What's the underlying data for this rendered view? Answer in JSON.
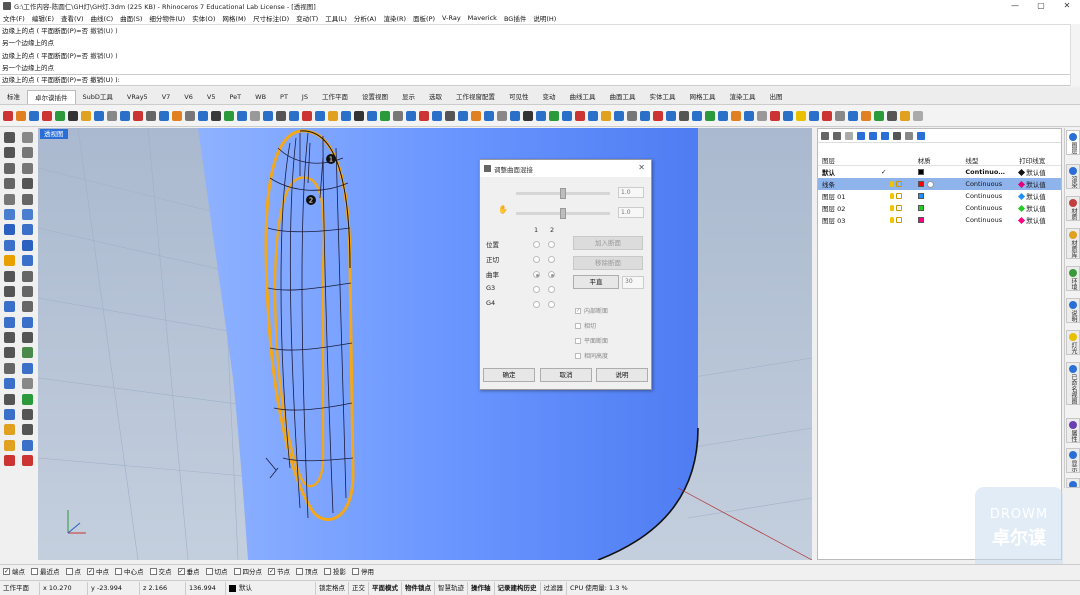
{
  "title": "G:\\工作内容-陈圆仁\\GH灯\\GH灯.3dm (225 KB) - Rhinoceros 7 Educational Lab License - [透视图]",
  "window_buttons": [
    "—",
    "▢",
    "✕"
  ],
  "menu": [
    "文件(F)",
    "编辑(E)",
    "查看(V)",
    "曲线(C)",
    "曲面(S)",
    "细分物件(U)",
    "实体(O)",
    "网格(M)",
    "尺寸标注(D)",
    "变动(T)",
    "工具(L)",
    "分析(A)",
    "渲染(R)",
    "面板(P)",
    "V-Ray",
    "Maverick",
    "BG插件",
    "说明(H)"
  ],
  "command_history": [
    {
      "text": "边缘上的点 ( 平面断面(P)=否 ",
      "underline": "撤销(U) )"
    },
    {
      "text": "另一个边缘上的点",
      "underline": ""
    },
    {
      "text": "边缘上的点 ( 平面断面(P)=否 ",
      "underline": "撤销(U) )"
    },
    {
      "text": "另一个边缘上的点",
      "underline": ""
    }
  ],
  "command_prompt": "边缘上的点 ( 平面断面(P)=否  撤销(U) ):",
  "tabs": [
    "标准",
    "卓尔谟插件",
    "SubD工具",
    "VRay5",
    "V7",
    "V6",
    "V5",
    "PeT",
    "WB",
    "PT",
    "JS",
    "工作平面",
    "设置视图",
    "显示",
    "选取",
    "工作视窗配置",
    "可见性",
    "变动",
    "曲线工具",
    "曲面工具",
    "实体工具",
    "网格工具",
    "渲染工具",
    "出图"
  ],
  "active_tab": "卓尔谟插件",
  "viewport_label": "透视图",
  "point_labels": [
    "1",
    "2"
  ],
  "dialog": {
    "title": "调整曲面混接",
    "slider_values": [
      "1.0",
      "1.0"
    ],
    "col_headers": [
      "1",
      "2"
    ],
    "rows": [
      "位置",
      "正切",
      "曲率",
      "G3",
      "G4"
    ],
    "buttons_right": {
      "add": "加入断面",
      "remove": "移除断面",
      "planar": "平直",
      "num": "30"
    },
    "checks": [
      {
        "label": "内部断面",
        "checked": true
      },
      {
        "label": "相切",
        "checked": false
      },
      {
        "label": "平面断面",
        "checked": false
      },
      {
        "label": "相同高度",
        "checked": false
      }
    ],
    "ok": "确定",
    "cancel": "取消",
    "help": "说明"
  },
  "layers": {
    "headers": {
      "name": "图层",
      "material": "材质",
      "linetype": "线型",
      "print": "打印线宽"
    },
    "rows": [
      {
        "name": "默认",
        "current": "✓",
        "color": "#000000",
        "linetype": "Continuo…",
        "print": "默认值",
        "bold": true,
        "selected": false
      },
      {
        "name": "线条",
        "current": "",
        "color": "#ff0000",
        "linetype": "Continuous",
        "print": "默认值",
        "bold": false,
        "selected": true
      },
      {
        "name": "图层 01",
        "current": "",
        "color": "#1e90ff",
        "linetype": "Continuous",
        "print": "默认值",
        "bold": false,
        "selected": false
      },
      {
        "name": "图层 02",
        "current": "",
        "color": "#22cc22",
        "linetype": "Continuous",
        "print": "默认值",
        "bold": false,
        "selected": false
      },
      {
        "name": "图层 03",
        "current": "",
        "color": "#ff0080",
        "linetype": "Continuous",
        "print": "默认值",
        "bold": false,
        "selected": false
      }
    ]
  },
  "side_tabs": [
    {
      "label": "图层",
      "color": "#2b6fd6"
    },
    {
      "label": "渲染",
      "color": "#2b6fd6"
    },
    {
      "label": "材质",
      "color": "#c04040"
    },
    {
      "label": "材质库",
      "color": "#e0a020"
    },
    {
      "label": "环境",
      "color": "#3a9a3a"
    },
    {
      "label": "说明",
      "color": "#2b6fd6"
    },
    {
      "label": "灯光",
      "color": "#e8c000"
    },
    {
      "label": "已命名视图",
      "color": "#2b6fd6"
    },
    {
      "label": "属性",
      "color": "#6a3fb0"
    },
    {
      "label": "显示",
      "color": "#2b6fd6"
    },
    {
      "label": "环境",
      "color": "#2b6fd6"
    }
  ],
  "osnaps": [
    {
      "label": "端点",
      "checked": true
    },
    {
      "label": "最近点",
      "checked": false
    },
    {
      "label": "点",
      "checked": false
    },
    {
      "label": "中点",
      "checked": true
    },
    {
      "label": "中心点",
      "checked": false
    },
    {
      "label": "交点",
      "checked": false
    },
    {
      "label": "垂点",
      "checked": true
    },
    {
      "label": "切点",
      "checked": false
    },
    {
      "label": "四分点",
      "checked": false
    },
    {
      "label": "节点",
      "checked": true
    },
    {
      "label": "顶点",
      "checked": false
    },
    {
      "label": "投影",
      "checked": false
    },
    {
      "label": "停用",
      "checked": false
    }
  ],
  "status": {
    "cplane": "工作平面",
    "x": "x 10.270",
    "y": "y -23.994",
    "z": "z 2.166",
    "dist": "136.994",
    "layer": "默认",
    "items": [
      "锁定格点",
      "正交",
      "平面模式",
      "物件锁点",
      "智慧轨迹",
      "操作轴",
      "记录建构历史",
      "过滤器"
    ],
    "cpu": "CPU 使用量: 1.3 %"
  },
  "watermark": {
    "top": "DROWM",
    "bottom": "卓尔谟"
  },
  "colors": {
    "accent": "#2b6fd6",
    "surface": "#6a9aff",
    "curve": "#f4a818"
  }
}
